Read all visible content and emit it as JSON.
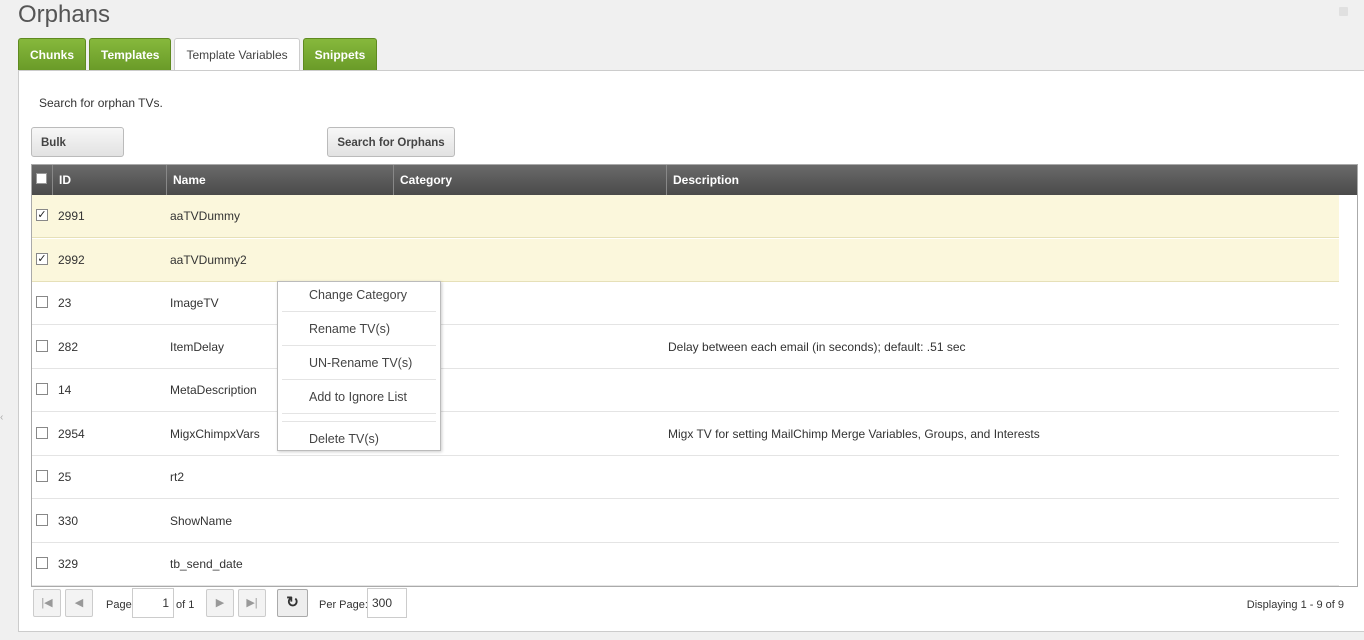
{
  "page": {
    "title": "Orphans"
  },
  "tabs": [
    {
      "label": "Chunks",
      "active": false
    },
    {
      "label": "Templates",
      "active": false
    },
    {
      "label": "Template Variables",
      "active": true
    },
    {
      "label": "Snippets",
      "active": false
    }
  ],
  "intro": "Search for orphan TVs.",
  "toolbar": {
    "bulk_label": "Bulk Actions",
    "search_label": "Search for Orphans"
  },
  "grid": {
    "columns": [
      "ID",
      "Name",
      "Category",
      "Description"
    ],
    "rows": [
      {
        "checked": true,
        "id": "2991",
        "name": "aaTVDummy",
        "category": "",
        "description": ""
      },
      {
        "checked": true,
        "id": "2992",
        "name": "aaTVDummy2",
        "category": "",
        "description": ""
      },
      {
        "checked": false,
        "id": "23",
        "name": "ImageTV",
        "category": "",
        "description": ""
      },
      {
        "checked": false,
        "id": "282",
        "name": "ItemDelay",
        "category": "esource",
        "description": "Delay between each email (in seconds); default: .51 sec"
      },
      {
        "checked": false,
        "id": "14",
        "name": "MetaDescription",
        "category": "",
        "description": ""
      },
      {
        "checked": false,
        "id": "2954",
        "name": "MigxChimpxVars",
        "category": "",
        "description": "Migx TV for setting MailChimp Merge Variables, Groups, and Interests"
      },
      {
        "checked": false,
        "id": "25",
        "name": "rt2",
        "category": "",
        "description": ""
      },
      {
        "checked": false,
        "id": "330",
        "name": "ShowName",
        "category": "",
        "description": ""
      },
      {
        "checked": false,
        "id": "329",
        "name": "tb_send_date",
        "category": "",
        "description": ""
      }
    ]
  },
  "context_menu": {
    "items": [
      "Change Category",
      "Rename TV(s)",
      "UN-Rename TV(s)",
      "Add to Ignore List",
      "Delete TV(s)"
    ]
  },
  "pager": {
    "page_label": "Page",
    "page_value": "1",
    "of_label": "of 1",
    "per_page_label": "Per Page:",
    "per_page_value": "300",
    "displaying": "Displaying 1 - 9 of 9"
  },
  "icons": {
    "first": "first-page-icon",
    "prev": "prev-page-icon",
    "next": "next-page-icon",
    "last": "last-page-icon",
    "refresh": "refresh-icon"
  },
  "colors": {
    "tab_green": "#6a9b28",
    "selected_row": "#fbf7dc",
    "header": "#555555"
  }
}
